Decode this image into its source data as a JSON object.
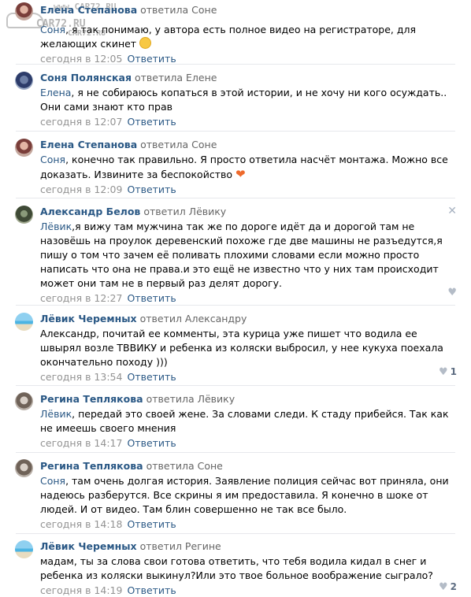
{
  "watermark": {
    "url_top": "www.CAR72.RU",
    "brand_mid": "CAR72.RU",
    "brand_bottom": "CAR72.RU"
  },
  "reply_label": "Ответить",
  "comments": [
    {
      "author": "Елена Степанова",
      "reply_to": "ответила Соне",
      "ref": "Соня",
      "text": ", я так понимаю, у автора есть полное видео на регистраторе, для желающих скинет",
      "emoji": "wink-emoji",
      "time": "сегодня в 12:05"
    },
    {
      "author": "Соня Полянская",
      "reply_to": "ответила Елене",
      "ref": "Елена",
      "text": ", я не собираюсь копаться в этой истории, и не хочу ни кого осуждать.. Они сами знают кто прав",
      "time": "сегодня в 12:07"
    },
    {
      "author": "Елена Степанова",
      "reply_to": "ответила Соне",
      "ref": "Соня",
      "text": ", конечно так правильно. Я просто ответила насчёт монтажа. Можно все доказать. Извините за беспокойство",
      "emoji": "heart-emoji",
      "time": "сегодня в 12:09"
    },
    {
      "author": "Александр Белов",
      "reply_to": "ответил Лёвику",
      "ref": "Лёвик",
      "text": ",я вижу там мужчина так же по дороге идёт да и дорогой там не назовёшь на проулок деревенский похоже где две машины не разъедутся,я пишу о том что зачем её поливать плохими словами если можно просто написать что она не права.и это ещё не известно что у них там происходит может они там не в первый раз делят дорогу.",
      "time": "сегодня в 12:27"
    },
    {
      "author": "Лёвик Черемных",
      "reply_to": "ответил Александру",
      "ref": "",
      "text": "Александр, почитай ее комменты, эта курица уже пишет что водила ее швырял возле ТВВИКУ и ребенка из коляски выбросил, у нее кукуха поехала окончательно походу )))",
      "time": "сегодня в 13:54",
      "likes": "1"
    },
    {
      "author": "Регина Теплякова",
      "reply_to": "ответила Лёвику",
      "ref": "Лёвик",
      "text": ", передай это своей жене. За словами следи. К стаду прибейся. Так как не имеешь своего мнения",
      "time": "сегодня в 14:17"
    },
    {
      "author": "Регина Теплякова",
      "reply_to": "ответила Соне",
      "ref": "Соня",
      "text": ", там очень долгая история. Заявление полиция сейчас вот приняла, они надеюсь разберутся. Все скрины я им предоставила. Я конечно в шоке от людей. И от видео. Там блин совершенно не так все было.",
      "time": "сегодня в 14:18"
    },
    {
      "author": "Лёвик Черемных",
      "reply_to": "ответил Регине",
      "ref": "",
      "text": "мадам, ты за слова свои готова ответить, что тебя водила кидал в снег и ребенка из коляски выкинул?Или это твое больное воображение сыграло?",
      "time": "сегодня в 14:19",
      "likes": "2"
    }
  ]
}
